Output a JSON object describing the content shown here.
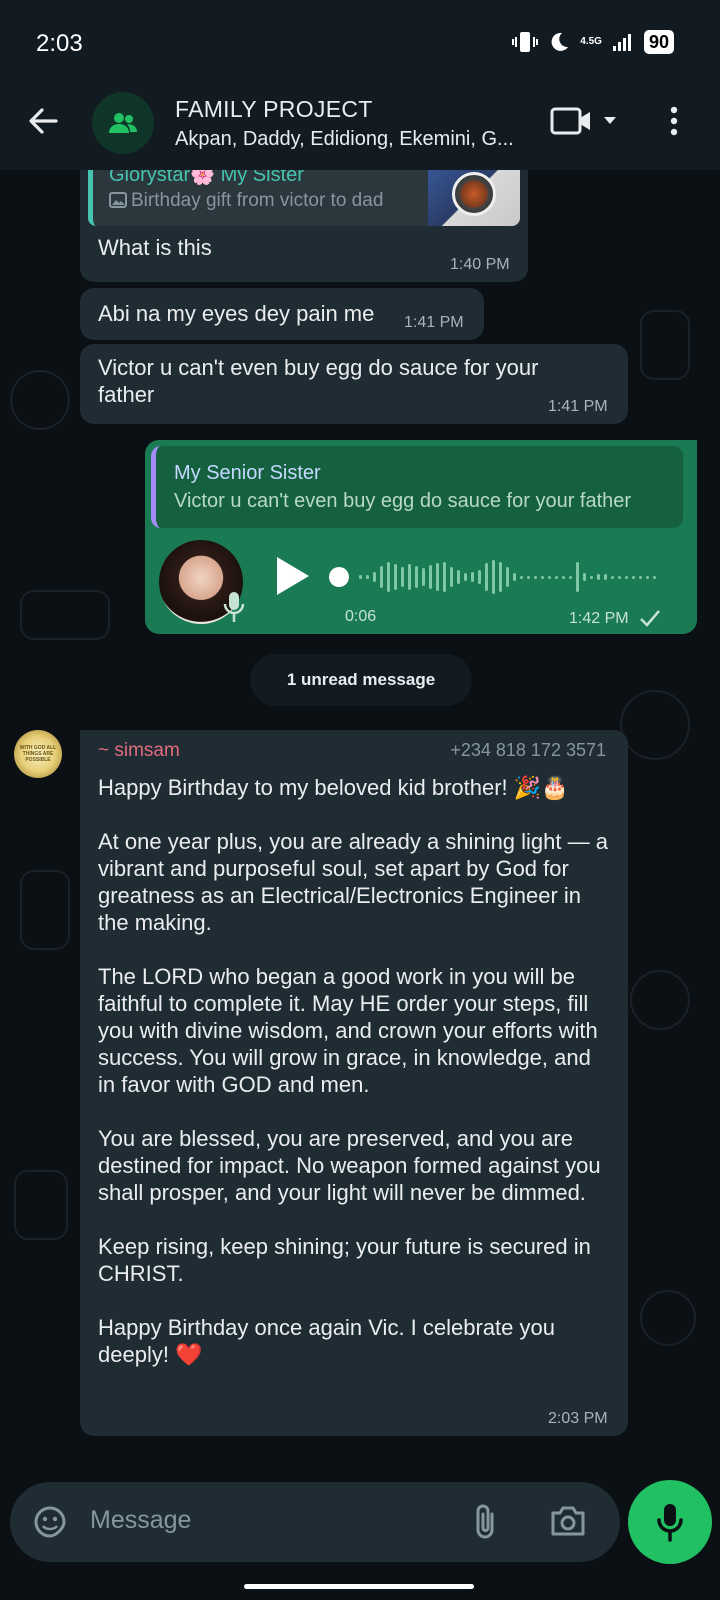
{
  "status_bar": {
    "time": "2:03",
    "network": "4.5G",
    "battery": "90"
  },
  "header": {
    "title": "FAMILY PROJECT",
    "subtitle": "Akpan, Daddy, Edidiong, Ekemini, G..."
  },
  "messages": [
    {
      "reply_to": {
        "name": "Glorystar🌸 My Sister",
        "snippet": "Birthday gift from victor to dad"
      },
      "text": "What is this",
      "time": "1:40 PM"
    },
    {
      "text": "Abi na my eyes dey pain me",
      "time": "1:41 PM"
    },
    {
      "text": "Victor u can't even buy egg do sauce for your father",
      "time": "1:41 PM"
    }
  ],
  "outgoing_voice": {
    "reply_to": {
      "name": "My Senior Sister",
      "snippet": "Victor u can't even buy egg do sauce for your father"
    },
    "duration": "0:06",
    "time": "1:42 PM",
    "status": "sent"
  },
  "unread_label": "1 unread message",
  "long_message": {
    "sender": "~ simsam",
    "phone": "+234 818 172 3571",
    "avatar_text": "WITH GOD ALL THINGS ARE POSSIBLE",
    "paragraphs": [
      "Happy Birthday to my beloved kid brother! 🎉🎂",
      "At one year plus, you are already a shining light — a vibrant and purposeful soul, set apart by God for greatness as an Electrical/Electronics Engineer in the making.",
      "The LORD who began a good work in you will be faithful to complete it. May HE order your steps, fill you with divine wisdom, and crown your efforts with success. You will grow in grace, in knowledge, and in favor with GOD and men.",
      "You are blessed, you are preserved, and you are destined for impact. No weapon formed against you shall prosper, and your light will never be dimmed.",
      "Keep rising, keep shining; your future is secured in CHRIST.",
      "Happy Birthday once again Vic. I celebrate you deeply! ❤️"
    ],
    "time": "2:03 PM"
  },
  "input": {
    "placeholder": "Message"
  },
  "colors": {
    "accent": "#21c063",
    "outgoing_bubble": "#1a7a53",
    "incoming_bubble": "#202c33",
    "sender_name": "#e26b7e"
  }
}
